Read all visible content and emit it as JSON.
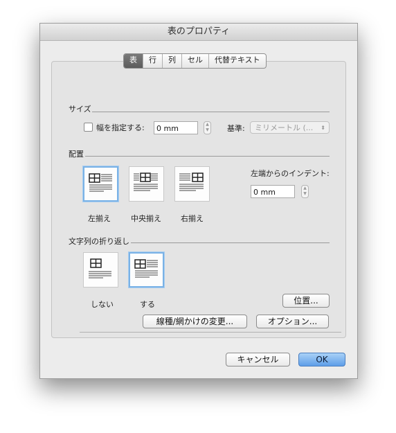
{
  "window": {
    "title": "表のプロパティ"
  },
  "tabs": [
    "表",
    "行",
    "列",
    "セル",
    "代替テキスト"
  ],
  "size": {
    "section": "サイズ",
    "width_label": "幅を指定する:",
    "width_checked": false,
    "width_value": "0 mm",
    "basis_label": "基準:",
    "basis_value": "ミリメートル (...",
    "basis_arrow": "⬍"
  },
  "alignment": {
    "section": "配置",
    "options": [
      {
        "label": "左揃え",
        "icon": "table-align-left-icon",
        "selected": true
      },
      {
        "label": "中央揃え",
        "icon": "table-align-center-icon",
        "selected": false
      },
      {
        "label": "右揃え",
        "icon": "table-align-right-icon",
        "selected": false
      }
    ],
    "indent_label": "左端からのインデント:",
    "indent_value": "0 mm"
  },
  "wrapping": {
    "section": "文字列の折り返し",
    "options": [
      {
        "label": "しない",
        "icon": "wrap-none-icon",
        "selected": false
      },
      {
        "label": "する",
        "icon": "wrap-around-icon",
        "selected": true
      }
    ],
    "position_button": "位置..."
  },
  "bottom_buttons": {
    "borders": "線種/網かけの変更...",
    "options": "オプション..."
  },
  "dialog_buttons": {
    "cancel": "キャンセル",
    "ok": "OK"
  },
  "colors": {
    "selection": "#7ab2e6",
    "default_button": "#5e9ee8",
    "active_tab": "#6a6a6a"
  }
}
